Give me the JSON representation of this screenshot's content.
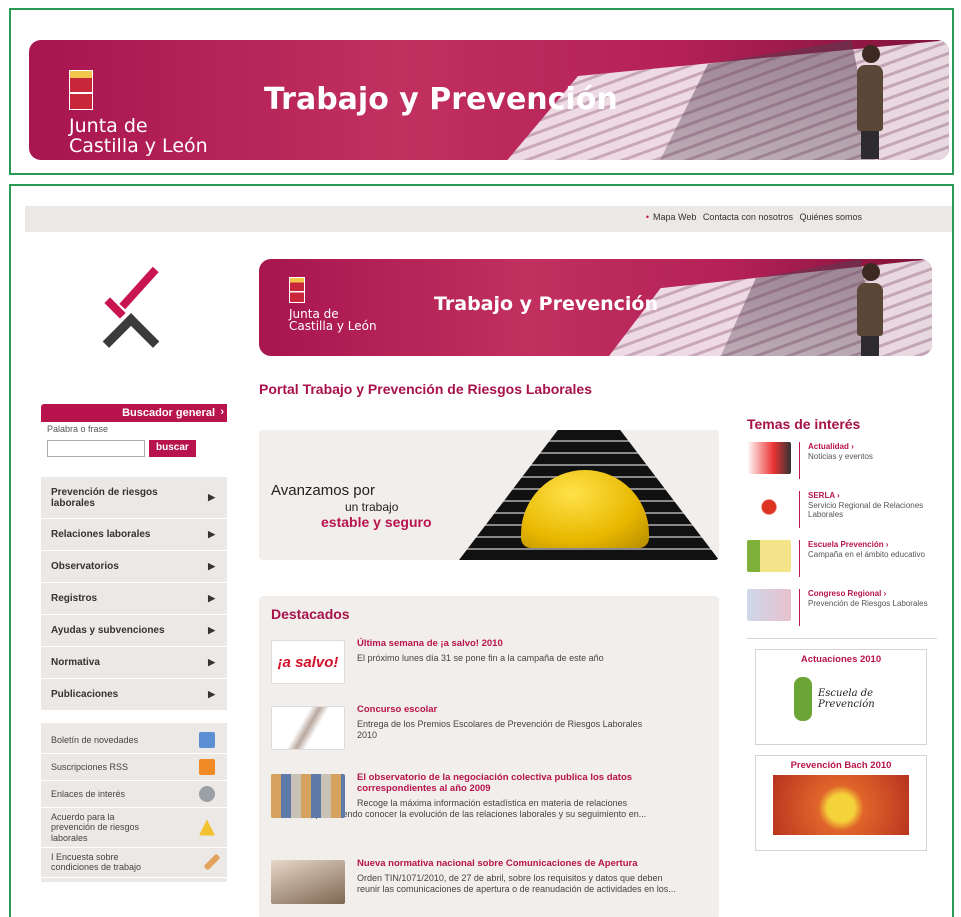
{
  "banner": {
    "logo_line1": "Junta de",
    "logo_line2": "Castilla y León",
    "title": "Trabajo y Prevención"
  },
  "toplinks": [
    "Mapa Web",
    "Contacta con nosotros",
    "Quiénes somos"
  ],
  "search": {
    "header": "Buscador general",
    "label": "Palabra o frase",
    "input_value": "",
    "button": "buscar"
  },
  "menu": [
    {
      "label": "Prevención de riesgos laborales"
    },
    {
      "label": "Relaciones laborales"
    },
    {
      "label": "Observatorios"
    },
    {
      "label": "Registros"
    },
    {
      "label": "Ayudas y subvenciones"
    },
    {
      "label": "Normativa"
    },
    {
      "label": "Publicaciones"
    }
  ],
  "extras": [
    {
      "label": "Boletín de novedades",
      "icon": "newsletter-icon",
      "color": "#5b8fd4"
    },
    {
      "label": "Suscripciones RSS",
      "icon": "rss-icon",
      "color": "#f08a24"
    },
    {
      "label": "Enlaces de interés",
      "icon": "links-icon",
      "color": "#9aa0a6"
    },
    {
      "label": "Acuerdo para la prevención de riesgos laborales",
      "icon": "warning-icon",
      "color": "#f2c230"
    },
    {
      "label": "I Encuesta sobre condiciones de trabajo",
      "icon": "pen-icon",
      "color": "#e2a35c"
    }
  ],
  "page_title": "Portal Trabajo y Prevención de Riesgos Laborales",
  "promo": {
    "line1": "Avanzamos por",
    "line2": "un trabajo",
    "line3": "estable y seguro"
  },
  "featured": {
    "title": "Destacados",
    "items": [
      {
        "head": "Última semana de ¡a salvo! 2010",
        "desc": "El próximo lunes día 31 se pone fin a la campaña de este año",
        "thumb_text": "¡a salvo!"
      },
      {
        "head": "Concurso escolar",
        "desc": "Entrega de los Premios Escolares de Prevención de Riesgos Laborales 2010"
      },
      {
        "head": "El observatorio de la negociación colectiva publica los datos correspondientes al año 2009",
        "desc": "Recoge la máxima información estadística en materia de relaciones colectivas, permitiendo conocer la evolución de las relaciones laborales y su seguimiento en..."
      },
      {
        "head": "Nueva normativa nacional sobre Comunicaciones de Apertura",
        "desc": "Orden TIN/1071/2010, de 27 de abril, sobre los requisitos y datos que deben reunir las comunicaciones de apertura o de reanudación de actividades en los..."
      }
    ]
  },
  "temas": {
    "title": "Temas de interés",
    "items": [
      {
        "head": "Actualidad",
        "desc": "Noticias y eventos"
      },
      {
        "head": "SERLA",
        "desc": "Servicio Regional de Relaciones Laborales"
      },
      {
        "head": "Escuela Prevención",
        "desc": "Campaña en el ámbito educativo"
      },
      {
        "head": "Congreso Regional",
        "desc": "Prevención de Riesgos Laborales"
      }
    ],
    "boxes": [
      {
        "title": "Actuaciones 2010",
        "caption": "Escuela de Prevención"
      },
      {
        "title": "Prevención Bach 2010"
      }
    ]
  },
  "colors": {
    "brand": "#b8134d",
    "frame": "#2a9a55"
  }
}
